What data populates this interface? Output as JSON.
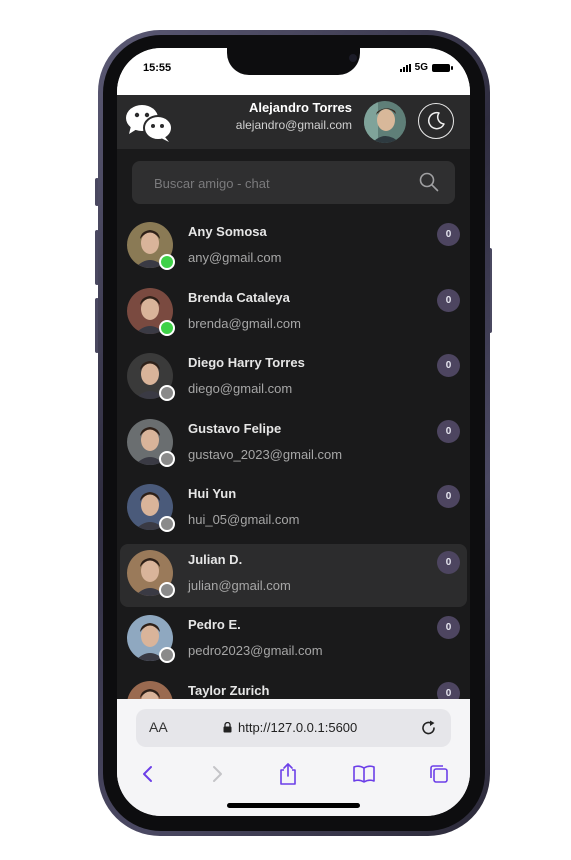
{
  "status_bar": {
    "time": "15:55",
    "network": "5G"
  },
  "header": {
    "user_name": "Alejandro Torres",
    "user_email": "alejandro@gmail.com",
    "logo_icon": "chat-bubbles-icon",
    "theme_icon": "moon-icon"
  },
  "search": {
    "placeholder": "Buscar amigo - chat",
    "value": "",
    "icon": "search-icon"
  },
  "contacts": [
    {
      "name": "Any Somosa",
      "email": "any@gmail.com",
      "unread": "0",
      "online": true,
      "avatar_color": "#8a7a55"
    },
    {
      "name": "Brenda Cataleya",
      "email": "brenda@gmail.com",
      "unread": "0",
      "online": true,
      "avatar_color": "#7a4a40"
    },
    {
      "name": "Diego Harry Torres",
      "email": "diego@gmail.com",
      "unread": "0",
      "online": false,
      "avatar_color": "#3a3a3a"
    },
    {
      "name": "Gustavo Felipe",
      "email": "gustavo_2023@gmail.com",
      "unread": "0",
      "online": false,
      "avatar_color": "#6a6e70"
    },
    {
      "name": "Hui Yun",
      "email": "hui_05@gmail.com",
      "unread": "0",
      "online": false,
      "avatar_color": "#4a5a7a"
    },
    {
      "name": "Julian D.",
      "email": "julian@gmail.com",
      "unread": "0",
      "online": false,
      "avatar_color": "#9a7a5a",
      "active": true
    },
    {
      "name": "Pedro E.",
      "email": "pedro2023@gmail.com",
      "unread": "0",
      "online": false,
      "avatar_color": "#8fa8c0"
    },
    {
      "name": "Taylor Zurich",
      "email": "",
      "unread": "0",
      "online": false,
      "avatar_color": "#9a6a50"
    }
  ],
  "browser": {
    "text_size_label": "AA",
    "url": "http://127.0.0.1:5600",
    "nav_icons": [
      "back-icon",
      "forward-icon",
      "share-icon",
      "bookmarks-icon",
      "tabs-icon"
    ]
  },
  "colors": {
    "online": "#3fd148",
    "offline": "#8a8a8a",
    "accent": "#6c3fe8",
    "badge": "#4d4560"
  }
}
